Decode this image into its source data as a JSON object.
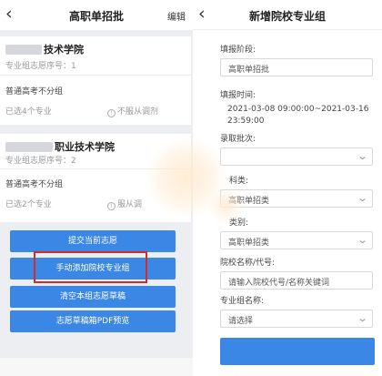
{
  "left": {
    "title": "高职单招批",
    "edit_label": "编辑",
    "cards": [
      {
        "name": "技术学院",
        "order": "专业组志愿序号：1",
        "group": "普通高考不分组",
        "selected": "已选4个专业",
        "adjust": "不服从调剂"
      },
      {
        "name": "职业技术学院",
        "order": "专业组志愿序号：2",
        "group": "普通高考不分组",
        "selected": "已选2个专业",
        "adjust": "服从调"
      }
    ],
    "buttons": {
      "submit": "提交当前志愿",
      "add_manual": "手动添加院校专业组",
      "clear": "清空本组志愿草稿",
      "preview_pdf": "志愿草稿箱PDF预览"
    }
  },
  "right": {
    "title": "新增院校专业组",
    "fields": {
      "stage_label": "填报阶段:",
      "stage_value": "高职单招批",
      "time_label": "填报时间:",
      "time_line1": "2021-03-08 09:00:00~2021-03-16",
      "time_line2": "23:59:00",
      "batch_label": "录取批次:",
      "category_label": "科类:",
      "category_value": "高职单招类",
      "type_label": "类别:",
      "type_value": "高职单招类",
      "school_label": "院校名称/代号:",
      "school_placeholder": "请输入院校代号/名称关键词",
      "group_label": "专业组名称:",
      "group_placeholder": "请选择"
    }
  },
  "colors": {
    "primary": "#3b87e6",
    "highlight": "#d42a2a"
  }
}
